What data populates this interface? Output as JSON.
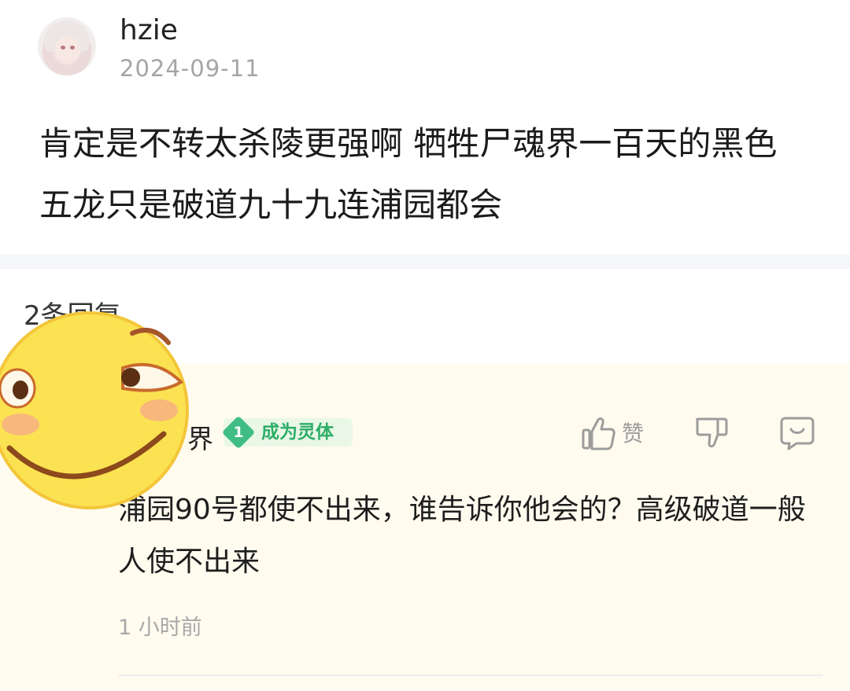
{
  "post": {
    "username": "hzie",
    "date": "2024-09-11",
    "content": "肯定是不转太杀陵更强啊 牺牲尸魂界一百天的黑色 五龙只是破道九十九连浦园都会"
  },
  "replies": {
    "count_label": "2条回复",
    "items": [
      {
        "username_visible": "界",
        "level": "1",
        "level_title": "成为灵体",
        "like_label": "赞",
        "content": "浦园90号都使不出来，谁告诉你他会的？高级破道一般人使不出来",
        "time": "1 小时前"
      }
    ]
  },
  "icons": {
    "like": "thumbs-up-icon",
    "dislike": "thumbs-down-icon",
    "reply": "comment-icon",
    "sticker": "smirk-emoji-sticker"
  },
  "colors": {
    "badge_green": "#3fbd83",
    "reply_bg": "#fffbef",
    "secondary_text": "#a5a5a5"
  }
}
